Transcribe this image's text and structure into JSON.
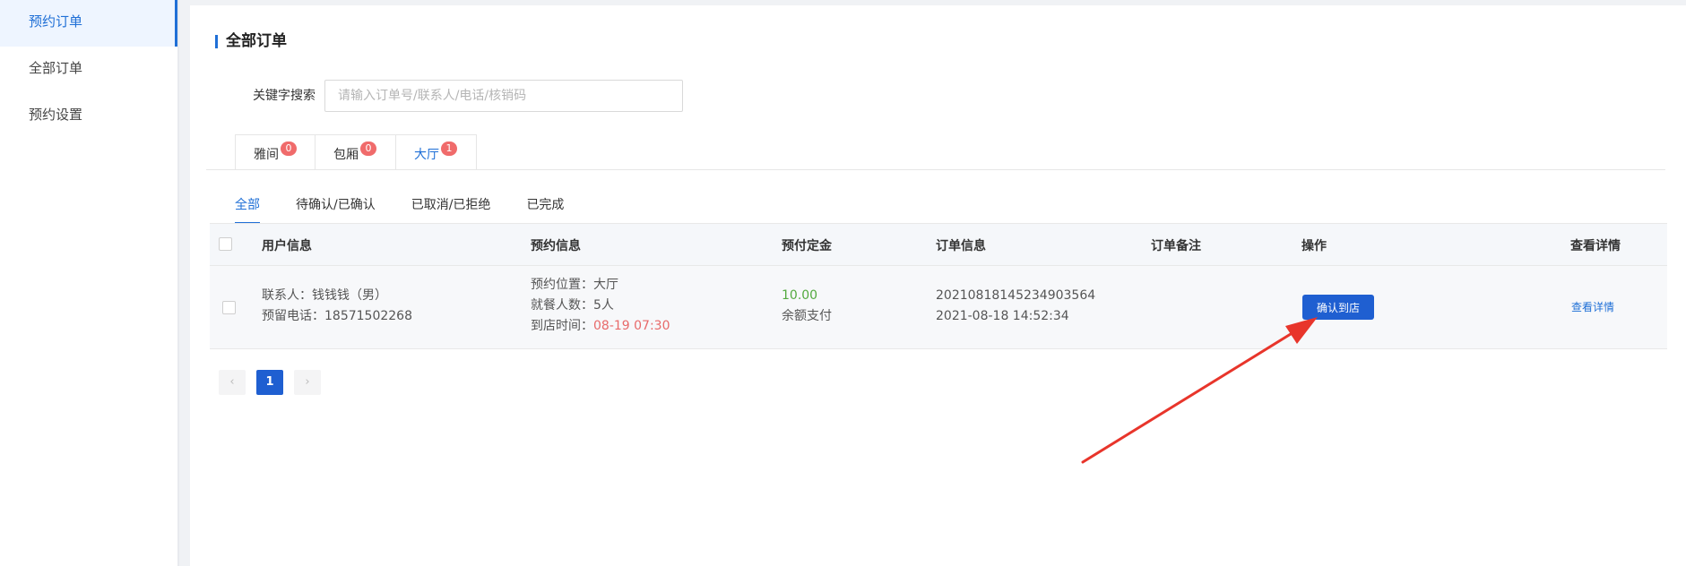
{
  "sidebar": {
    "items": [
      {
        "label": "预约订单",
        "active": true
      },
      {
        "label": "全部订单",
        "active": false
      },
      {
        "label": "预约设置",
        "active": false
      }
    ]
  },
  "page": {
    "title": "全部订单"
  },
  "search": {
    "label": "关键字搜索",
    "placeholder": "请输入订单号/联系人/电话/核销码",
    "value": ""
  },
  "room_tabs": [
    {
      "label": "雅间",
      "badge": "0",
      "active": false
    },
    {
      "label": "包厢",
      "badge": "0",
      "active": false
    },
    {
      "label": "大厅",
      "badge": "1",
      "active": true
    }
  ],
  "status_tabs": [
    {
      "label": "全部",
      "active": true
    },
    {
      "label": "待确认/已确认",
      "active": false
    },
    {
      "label": "已取消/已拒绝",
      "active": false
    },
    {
      "label": "已完成",
      "active": false
    }
  ],
  "table": {
    "headers": {
      "user_info": "用户信息",
      "reservation_info": "预约信息",
      "deposit": "预付定金",
      "order_info": "订单信息",
      "remark": "订单备注",
      "action": "操作",
      "details": "查看详情"
    },
    "rows": [
      {
        "contact": "联系人：钱钱钱（男）",
        "phone": "预留电话：18571502268",
        "location": "预约位置：大厅",
        "diners": "就餐人数：5人",
        "arrival_label": "到店时间：",
        "arrival_time": "08-19 07:30",
        "amount": "10.00",
        "payment": "余额支付",
        "order_no": "20210818145234903564",
        "order_time": "2021-08-18 14:52:34",
        "remark": "",
        "action_label": "确认到店",
        "details_label": "查看详情"
      }
    ]
  },
  "pagination": {
    "prev": "‹",
    "current": "1",
    "next": "›"
  },
  "colors": {
    "accent": "#1f6fd6",
    "button": "#1f5fd1",
    "badge": "#f06b6b",
    "arrival_time": "#e86a6a",
    "amount": "#53a93f",
    "annotation_arrow": "#e8352b"
  }
}
